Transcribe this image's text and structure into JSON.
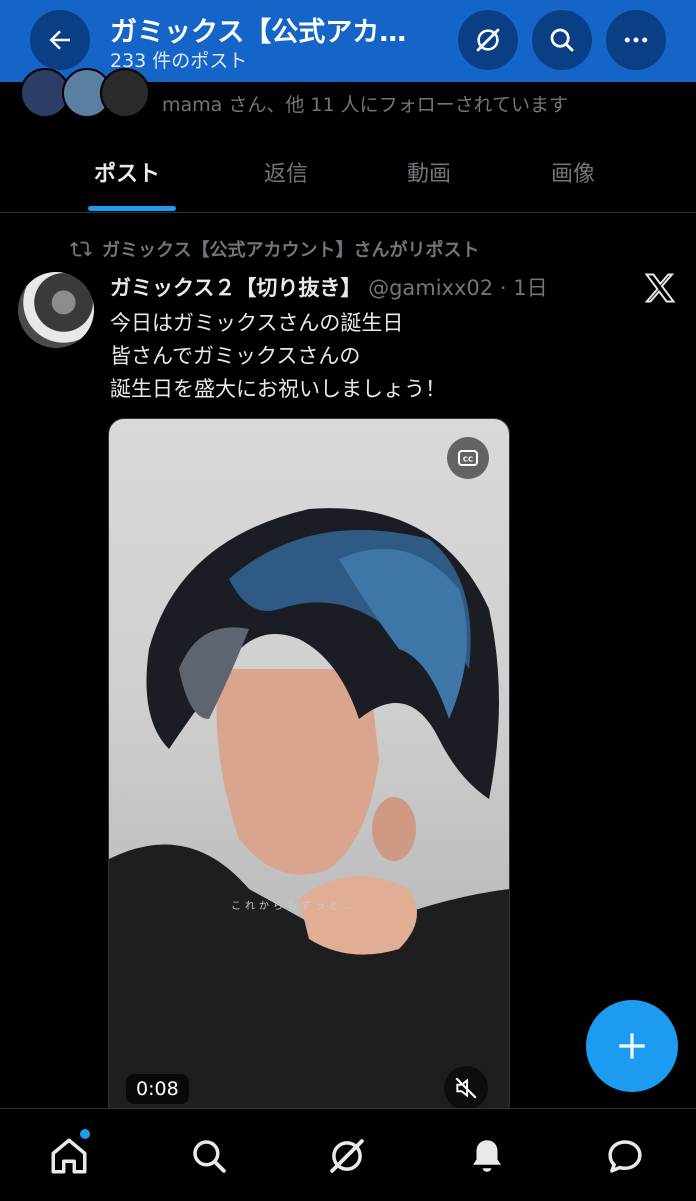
{
  "header": {
    "title": "ガミックス【公式アカ…",
    "subtitle": "233 件のポスト",
    "back_icon": "arrow-left-icon",
    "grok_icon": "grok-icon",
    "search_icon": "search-icon",
    "more_icon": "more-icon",
    "bar_color": "#1565c8"
  },
  "profile": {
    "followed_by_text": "mama さん、他 11 人にフォローされています"
  },
  "tabs": [
    {
      "label": "ポスト",
      "active": true
    },
    {
      "label": "返信",
      "active": false
    },
    {
      "label": "動画",
      "active": false
    },
    {
      "label": "画像",
      "active": false
    }
  ],
  "post": {
    "repost_label": "ガミックス【公式アカウント】さんがリポスト",
    "author_name": "ガミックス２【切り抜き】",
    "handle": "@gamixx02",
    "separator": "·",
    "time": "1日",
    "text_lines": [
      "今日はガミックスさんの誕生日",
      "皆さんでガミックスさんの",
      "誕生日を盛大にお祝いしましょう！"
    ],
    "video": {
      "duration": "0:08",
      "caption": "これからもずっと…",
      "cc_icon": "closed-caption-icon",
      "mute_icon": "volume-muted-icon"
    },
    "source_logo": "x-logo-icon"
  },
  "fab": {
    "icon": "plus-icon",
    "color": "#1d9bf0"
  },
  "bottom_nav": [
    {
      "name": "home",
      "icon": "home-icon",
      "has_dot": true
    },
    {
      "name": "search",
      "icon": "search-icon"
    },
    {
      "name": "grok",
      "icon": "grok-icon"
    },
    {
      "name": "notifications",
      "icon": "bell-icon"
    },
    {
      "name": "messages",
      "icon": "chat-bubble-icon"
    }
  ]
}
